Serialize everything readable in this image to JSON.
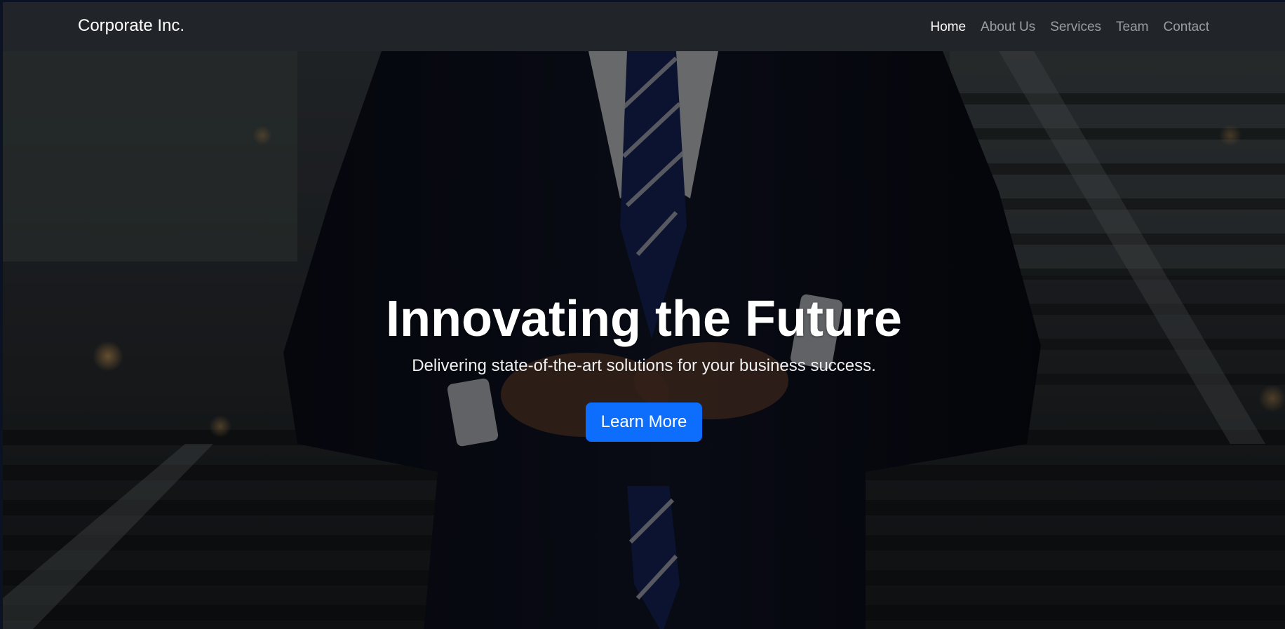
{
  "navbar": {
    "brand": "Corporate Inc.",
    "links": [
      {
        "label": "Home",
        "active": true
      },
      {
        "label": "About Us",
        "active": false
      },
      {
        "label": "Services",
        "active": false
      },
      {
        "label": "Team",
        "active": false
      },
      {
        "label": "Contact",
        "active": false
      }
    ]
  },
  "hero": {
    "title": "Innovating the Future",
    "subtitle": "Delivering state-of-the-art solutions for your business success.",
    "cta_label": "Learn More"
  },
  "colors": {
    "navbar_bg": "#212529",
    "primary_button": "#0d6efd",
    "text_light": "#ffffff"
  }
}
